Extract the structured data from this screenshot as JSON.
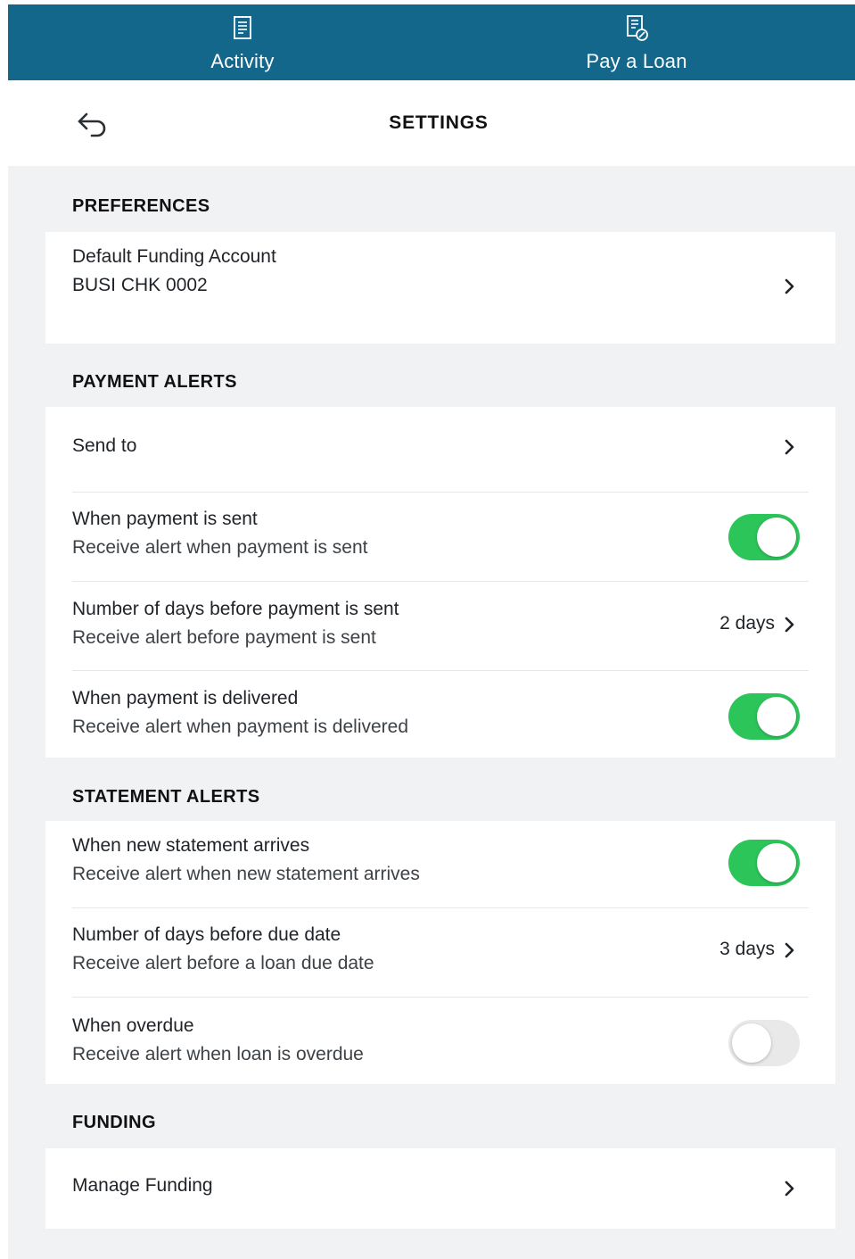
{
  "top_nav": {
    "tabs": [
      {
        "label": "Activity",
        "icon": "receipt-icon"
      },
      {
        "label": "Pay a Loan",
        "icon": "bill-pay-icon"
      }
    ],
    "background": "#13678a"
  },
  "header": {
    "title": "SETTINGS",
    "back_icon": "back-arrow-icon"
  },
  "preferences": {
    "title": "PREFERENCES",
    "default_funding": {
      "label": "Default Funding Account",
      "value": "BUSI CHK 0002"
    }
  },
  "payment_alerts": {
    "title": "PAYMENT ALERTS",
    "send_to": {
      "label": "Send to"
    },
    "payment_sent": {
      "label": "When payment is sent",
      "description": "Receive alert when payment is sent",
      "enabled": true
    },
    "days_before_sent": {
      "label": "Number of days before payment is sent",
      "description": "Receive alert before payment is sent",
      "value": "2 days"
    },
    "payment_delivered": {
      "label": "When payment is delivered",
      "description": "Receive alert when payment is delivered",
      "enabled": true
    }
  },
  "statement_alerts": {
    "title": "STATEMENT ALERTS",
    "new_statement": {
      "label": "When new statement arrives",
      "description": "Receive alert when new statement arrives",
      "enabled": true
    },
    "days_before_due": {
      "label": "Number of days before due date",
      "description": "Receive alert before a loan due date",
      "value": "3 days"
    },
    "overdue": {
      "label": "When overdue",
      "description": "Receive alert when loan is overdue",
      "enabled": false
    }
  },
  "funding": {
    "title": "FUNDING",
    "manage": {
      "label": "Manage Funding"
    }
  },
  "colors": {
    "toggle_on": "#2cc55a",
    "toggle_off": "#e9e9ea",
    "page_background": "#f1f2f4"
  }
}
